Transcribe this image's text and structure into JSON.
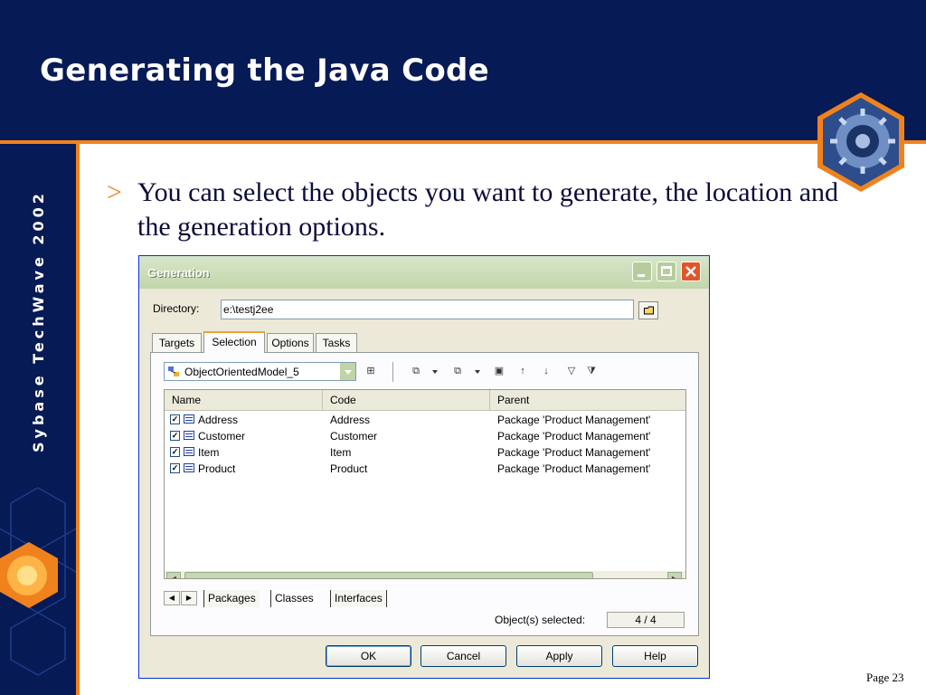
{
  "slide": {
    "title": "Generating the Java Code",
    "sidebar_text": "Sybase TechWave 2002",
    "bullet_marker": ">",
    "bullet_text": "You can select the objects you want to generate, the location and the generation options.",
    "page_number": "Page 23"
  },
  "colors": {
    "navy": "#061a55",
    "orange": "#f0821e",
    "xp_title_green": "#c2d6ab",
    "dialog_face": "#ece9d8"
  },
  "dialog": {
    "title": "Generation",
    "directory_label": "Directory:",
    "directory_value": "e:\\testj2ee",
    "tabs": [
      {
        "label": "Targets",
        "active": false
      },
      {
        "label": "Selection",
        "active": true
      },
      {
        "label": "Options",
        "active": false
      },
      {
        "label": "Tasks",
        "active": false
      }
    ],
    "model_select": "ObjectOrientedModel_5",
    "columns": [
      "Name",
      "Code",
      "Parent"
    ],
    "rows": [
      {
        "checked": true,
        "name": "Address",
        "code": "Address",
        "parent": "Package 'Product Management'"
      },
      {
        "checked": true,
        "name": "Customer",
        "code": "Customer",
        "parent": "Package 'Product Management'"
      },
      {
        "checked": true,
        "name": "Item",
        "code": "Item",
        "parent": "Package 'Product Management'"
      },
      {
        "checked": true,
        "name": "Product",
        "code": "Product",
        "parent": "Package 'Product Management'"
      }
    ],
    "sheet_tabs": [
      "Packages",
      "Classes",
      "Interfaces"
    ],
    "objects_selected_label": "Object(s) selected:",
    "objects_selected_value": "4 / 4",
    "buttons": {
      "ok": "OK",
      "cancel": "Cancel",
      "apply": "Apply",
      "help": "Help"
    }
  }
}
